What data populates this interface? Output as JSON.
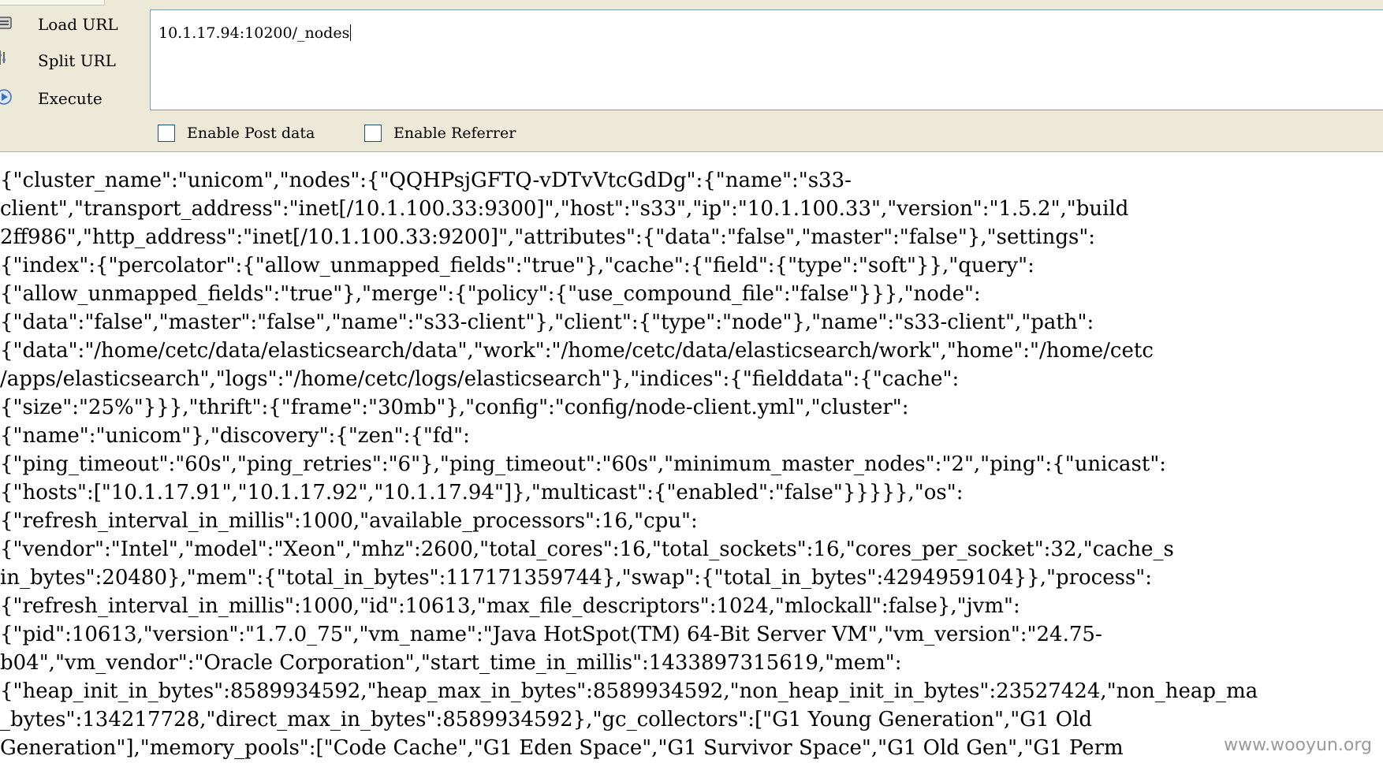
{
  "toolbar": {
    "load_url_label": "Load URL",
    "split_url_label": "Split URL",
    "execute_label": "Execute",
    "url_value": "10.1.17.94:10200/_nodes",
    "enable_post_label": "Enable Post data",
    "enable_referrer_label": "Enable Referrer",
    "enable_post_checked": false,
    "enable_referrer_checked": false
  },
  "response": {
    "lines": [
      "{\"cluster_name\":\"unicom\",\"nodes\":{\"QQHPsjGFTQ-vDTvVtcGdDg\":{\"name\":\"s33-",
      "client\",\"transport_address\":\"inet[/10.1.100.33:9300]\",\"host\":\"s33\",\"ip\":\"10.1.100.33\",\"version\":\"1.5.2\",\"build",
      "2ff986\",\"http_address\":\"inet[/10.1.100.33:9200]\",\"attributes\":{\"data\":\"false\",\"master\":\"false\"},\"settings\":",
      "{\"index\":{\"percolator\":{\"allow_unmapped_fields\":\"true\"},\"cache\":{\"field\":{\"type\":\"soft\"}},\"query\":",
      "{\"allow_unmapped_fields\":\"true\"},\"merge\":{\"policy\":{\"use_compound_file\":\"false\"}}},\"node\":",
      "{\"data\":\"false\",\"master\":\"false\",\"name\":\"s33-client\"},\"client\":{\"type\":\"node\"},\"name\":\"s33-client\",\"path\":",
      "{\"data\":\"/home/cetc/data/elasticsearch/data\",\"work\":\"/home/cetc/data/elasticsearch/work\",\"home\":\"/home/cetc",
      "/apps/elasticsearch\",\"logs\":\"/home/cetc/logs/elasticsearch\"},\"indices\":{\"fielddata\":{\"cache\":",
      "{\"size\":\"25%\"}}},\"thrift\":{\"frame\":\"30mb\"},\"config\":\"config/node-client.yml\",\"cluster\":",
      "{\"name\":\"unicom\"},\"discovery\":{\"zen\":{\"fd\":",
      "{\"ping_timeout\":\"60s\",\"ping_retries\":\"6\"},\"ping_timeout\":\"60s\",\"minimum_master_nodes\":\"2\",\"ping\":{\"unicast\":",
      "{\"hosts\":[\"10.1.17.91\",\"10.1.17.92\",\"10.1.17.94\"]},\"multicast\":{\"enabled\":\"false\"}}}}},\"os\":",
      "{\"refresh_interval_in_millis\":1000,\"available_processors\":16,\"cpu\":",
      "{\"vendor\":\"Intel\",\"model\":\"Xeon\",\"mhz\":2600,\"total_cores\":16,\"total_sockets\":16,\"cores_per_socket\":32,\"cache_s",
      "in_bytes\":20480},\"mem\":{\"total_in_bytes\":117171359744},\"swap\":{\"total_in_bytes\":4294959104}},\"process\":",
      "{\"refresh_interval_in_millis\":1000,\"id\":10613,\"max_file_descriptors\":1024,\"mlockall\":false},\"jvm\":",
      "{\"pid\":10613,\"version\":\"1.7.0_75\",\"vm_name\":\"Java HotSpot(TM) 64-Bit Server VM\",\"vm_version\":\"24.75-",
      "b04\",\"vm_vendor\":\"Oracle Corporation\",\"start_time_in_millis\":1433897315619,\"mem\":",
      "{\"heap_init_in_bytes\":8589934592,\"heap_max_in_bytes\":8589934592,\"non_heap_init_in_bytes\":23527424,\"non_heap_ma",
      "_bytes\":134217728,\"direct_max_in_bytes\":8589934592},\"gc_collectors\":[\"G1 Young Generation\",\"G1 Old",
      "Generation\"],\"memory_pools\":[\"Code Cache\",\"G1 Eden Space\",\"G1 Survivor Space\",\"G1 Old Gen\",\"G1 Perm"
    ]
  },
  "watermark": "www.wooyun.org",
  "colors": {
    "toolbar_bg": "#ece9d8",
    "input_border": "#7f9db9",
    "checkbox_border": "#1c5180",
    "text": "#000000",
    "watermark": "#9a9a9a"
  },
  "icons": {
    "load_url": "load-url-icon",
    "split_url": "split-url-icon",
    "execute": "execute-icon"
  }
}
